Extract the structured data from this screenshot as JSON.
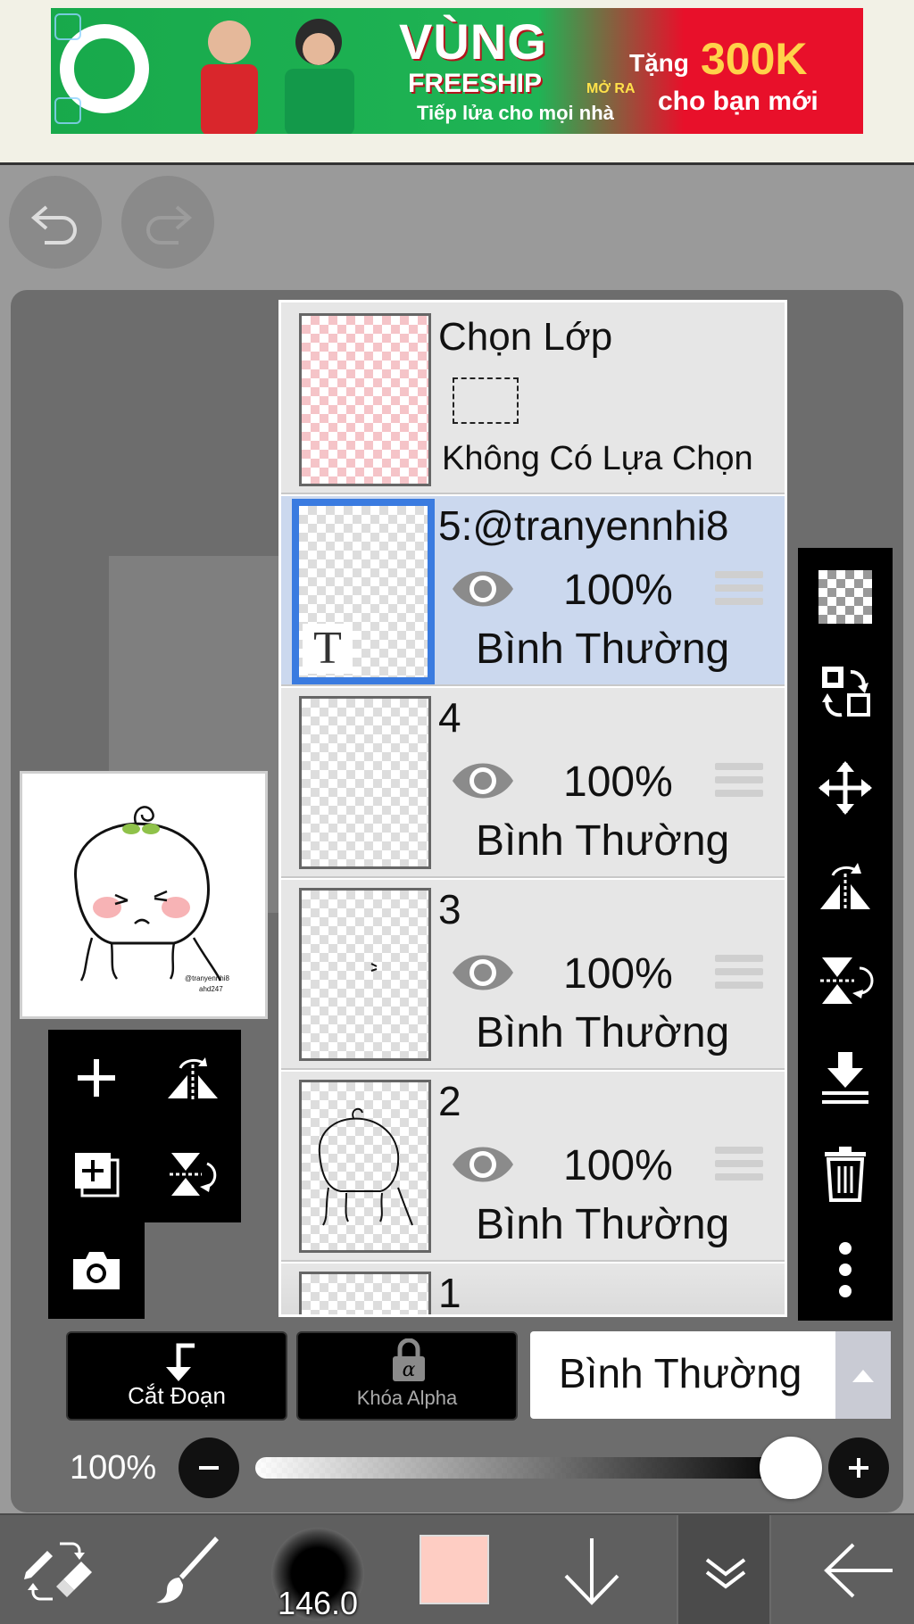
{
  "ad": {
    "title": "VÙNG",
    "subtitle": "FREESHIP",
    "mo_ra": "MỞ RA",
    "tagline": "Tiếp lửa cho mọi nhà",
    "tang": "Tặng",
    "amount": "300K",
    "cho_ban_moi": "cho bạn mới"
  },
  "layers_panel": {
    "selection": {
      "title": "Chọn Lớp",
      "status": "Không Có Lựa Chọn"
    },
    "layers": [
      {
        "name": "5:@tranyennhi8",
        "opacity": "100%",
        "blend": "Bình Thường",
        "active": true,
        "type": "text"
      },
      {
        "name": "4",
        "opacity": "100%",
        "blend": "Bình Thường",
        "active": false
      },
      {
        "name": "3",
        "opacity": "100%",
        "blend": "Bình Thường",
        "active": false
      },
      {
        "name": "2",
        "opacity": "100%",
        "blend": "Bình Thường",
        "active": false
      },
      {
        "name": "1"
      }
    ]
  },
  "bottom_controls": {
    "clip_label": "Cắt Đoạn",
    "alpha_lock_label": "Khóa Alpha",
    "blend_mode": "Bình Thường",
    "opacity_value": "100%",
    "opacity_fraction": 1.0
  },
  "toolbar": {
    "brush_size": "146.0",
    "color": "#fecdc3"
  },
  "preview": {
    "watermark_line1": "@tranyennhi8",
    "watermark_line2": "ahd247"
  },
  "icons": {
    "undo": "undo-icon",
    "redo": "redo-icon",
    "add_layer": "plus-icon",
    "flip_h": "flip-horizontal-icon",
    "add_copy": "add-copy-icon",
    "flip_v": "flip-vertical-icon",
    "camera": "camera-icon",
    "transparent": "transparency-icon",
    "swap": "swap-icon",
    "move": "move-icon",
    "merge_down": "merge-down-icon",
    "delete": "trash-icon",
    "more": "more-vertical-icon"
  }
}
